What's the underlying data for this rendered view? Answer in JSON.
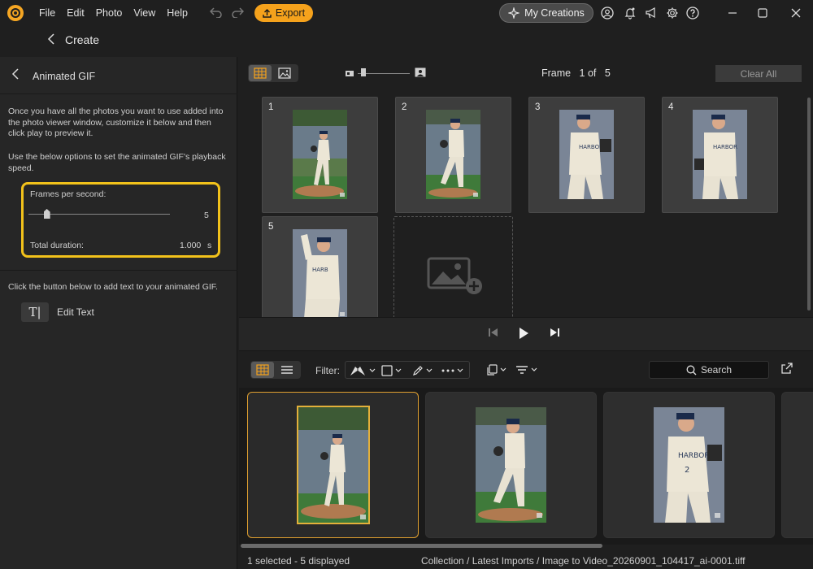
{
  "menu": {
    "items": [
      "File",
      "Edit",
      "Photo",
      "View",
      "Help"
    ]
  },
  "toolbar": {
    "export_label": "Export",
    "my_creations_label": "My Creations"
  },
  "create": {
    "title": "Create"
  },
  "panel": {
    "title": "Animated GIF",
    "intro": "Once you have all the photos you want to use added into the photo viewer window, customize it below and then click play to preview it.",
    "speed_hint": "Use the below options to set the animated GIF's playback speed.",
    "fps_label": "Frames per second:",
    "fps_value": "5",
    "fps_level": 0.13,
    "duration_label": "Total duration:",
    "duration_value": "1.000",
    "duration_unit": "s",
    "text_hint": "Click the button below to add text to your animated GIF.",
    "edit_text_label": "Edit Text",
    "edit_text_icon": "T|"
  },
  "viewer": {
    "frame_label": "Frame",
    "frame_current": "1",
    "frame_of": "of",
    "frame_total": "5",
    "clear_all_label": "Clear All",
    "frames": [
      {
        "num": "1"
      },
      {
        "num": "2"
      },
      {
        "num": "3"
      },
      {
        "num": "4"
      },
      {
        "num": "5"
      }
    ]
  },
  "filmbar": {
    "filter_label": "Filter:",
    "search_label": "Search"
  },
  "status": {
    "selection": "1 selected - 5 displayed",
    "path": "Collection / Latest Imports / Image to Video_20260901_104417_ai-0001.tiff"
  },
  "colors": {
    "accent": "#f5a21c",
    "highlight": "#f2c21b",
    "selected_border": "#e0a030"
  }
}
